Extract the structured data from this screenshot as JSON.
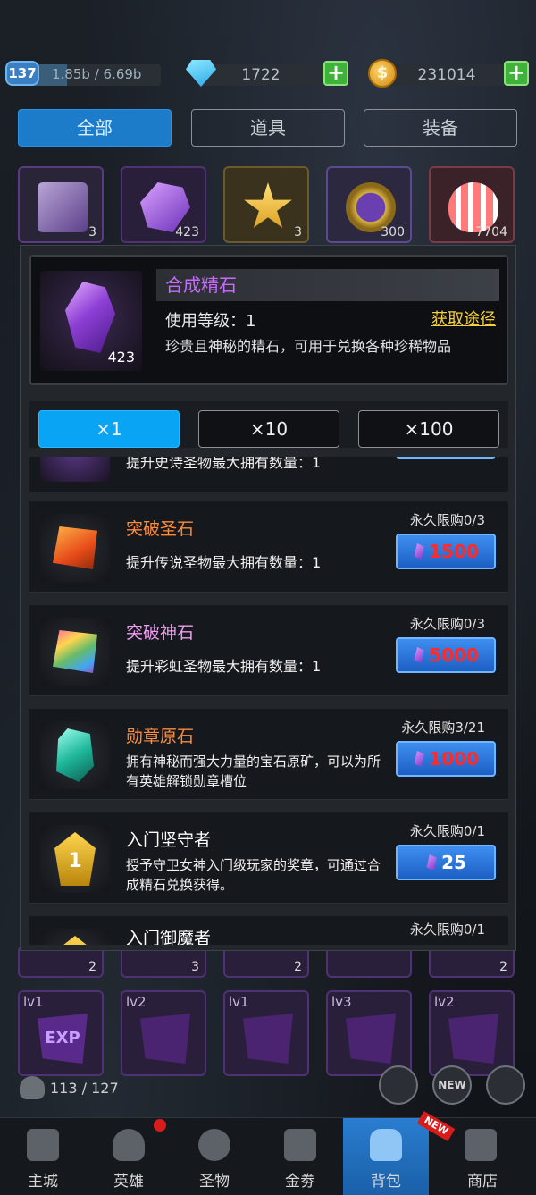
{
  "topbar": {
    "level": "137",
    "exp_text": "1.85b / 6.69b",
    "exp_progress": 0.28,
    "gems": "1722",
    "coins": "231014",
    "plus": "+"
  },
  "tabs": [
    {
      "label": "全部",
      "active": true
    },
    {
      "label": "道具",
      "active": false
    },
    {
      "label": "装备",
      "active": false
    }
  ],
  "inventory_top": [
    {
      "count": "3"
    },
    {
      "count": "423"
    },
    {
      "count": "3"
    },
    {
      "count": "300"
    },
    {
      "count": "7704"
    }
  ],
  "detail": {
    "name": "合成精石",
    "use_level": "使用等级：1",
    "obtain_label": "获取途径",
    "description": "珍贵且神秘的精石，可用于兑换各种珍稀物品",
    "count": "423"
  },
  "quantity": [
    {
      "label": "×1",
      "active": true
    },
    {
      "label": "×10",
      "active": false
    },
    {
      "label": "×100",
      "active": false
    }
  ],
  "shop_items": [
    {
      "name": "",
      "desc": "提升史诗圣物最大拥有数量：1",
      "limit": "",
      "price": "",
      "name_color": "#ffffff"
    },
    {
      "name": "突破圣石",
      "desc": "提升传说圣物最大拥有数量：1",
      "limit": "永久限购0/3",
      "price": "1500",
      "name_color": "#ff8c3a",
      "price_color": "red"
    },
    {
      "name": "突破神石",
      "desc": "提升彩虹圣物最大拥有数量：1",
      "limit": "永久限购0/3",
      "price": "5000",
      "name_color": "#f09cf0",
      "price_color": "red"
    },
    {
      "name": "勋章原石",
      "desc": "拥有神秘而强大力量的宝石原矿，可以为所有英雄解锁勋章槽位",
      "limit": "永久限购3/21",
      "price": "1000",
      "name_color": "#ff8c3a",
      "price_color": "red"
    },
    {
      "name": "入门坚守者",
      "desc": "授予守卫女神入门级玩家的奖章，可通过合成精石兑换获得。",
      "limit": "永久限购0/1",
      "price": "25",
      "name_color": "#ffffff",
      "price_color": "white"
    },
    {
      "name": "入门御魔者",
      "desc": "",
      "limit": "永久限购0/1",
      "price": "",
      "name_color": "#ffffff"
    }
  ],
  "inventory_bottom_counts": [
    "2",
    "3",
    "2",
    "",
    "2"
  ],
  "inventory_bottom": [
    {
      "level": "lv1",
      "label": "EXP"
    },
    {
      "level": "lv2",
      "label": ""
    },
    {
      "level": "lv1",
      "label": ""
    },
    {
      "level": "lv3",
      "label": ""
    },
    {
      "level": "lv2",
      "label": ""
    }
  ],
  "bag_capacity": "113 / 127",
  "action_buttons": [
    "",
    "NEW",
    ""
  ],
  "bottom_nav": [
    {
      "label": "主城",
      "active": false
    },
    {
      "label": "英雄",
      "active": false
    },
    {
      "label": "圣物",
      "active": false
    },
    {
      "label": "金劵",
      "active": false
    },
    {
      "label": "背包",
      "active": true
    },
    {
      "label": "商店",
      "active": false
    }
  ],
  "new_tag": "NEW",
  "colors": {
    "accent": "#1d7cc9",
    "qty_active": "#0aa4f5",
    "item_name_purple": "#c96aff",
    "price_red": "#ff2a2a"
  }
}
